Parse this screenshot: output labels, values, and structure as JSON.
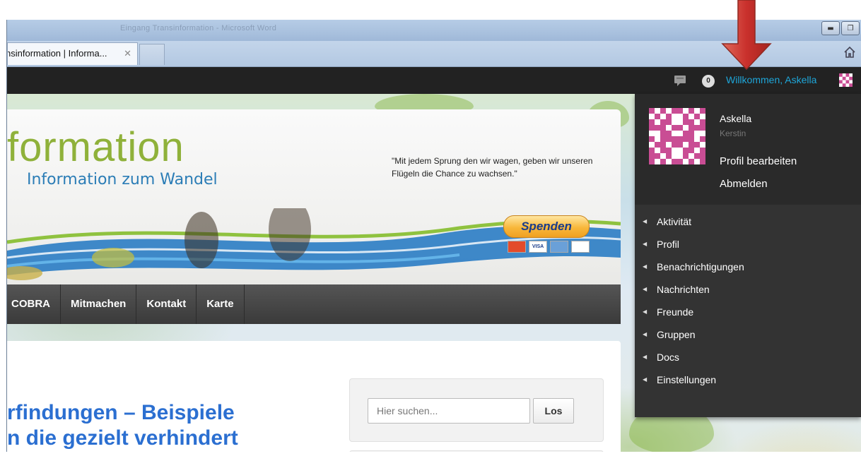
{
  "window": {
    "title": "Eingang Transinformation - Microsoft Word",
    "minimize_icon": "minimize-icon",
    "maximize_icon": "restore-icon"
  },
  "browser": {
    "tab_title": "nsinformation | Informa...",
    "tab_close": "✕",
    "home_icon": "home-icon"
  },
  "adminbar": {
    "comment_icon": "comment-bubble-icon",
    "notification_count": "0",
    "welcome": "Willkommen, Askella"
  },
  "banner": {
    "logo_main": "formation",
    "logo_sub": "Information zum Wandel",
    "quote": "\"Mit jedem Sprung den wir wagen, geben wir unseren Flügeln die Chance zu wachsen.\"",
    "donate": "Spenden",
    "cards": [
      "",
      "VISA",
      "",
      ""
    ]
  },
  "nav": {
    "items": [
      "COBRA",
      "Mitmachen",
      "Kontakt",
      "Karte"
    ]
  },
  "content": {
    "headline_line1": "rfindungen – Beispiele",
    "headline_line2": "n die gezielt verhindert",
    "search_placeholder": "Hier suchen...",
    "search_button": "Los"
  },
  "dropdown": {
    "name": "Askella",
    "subname": "Kerstin",
    "edit_profile": "Profil bearbeiten",
    "logout": "Abmelden",
    "menu": [
      "Aktivität",
      "Profil",
      "Benachrichtigungen",
      "Nachrichten",
      "Freunde",
      "Gruppen",
      "Docs",
      "Einstellungen"
    ]
  },
  "colors": {
    "accent_link": "#1ea6d9",
    "headline": "#2b6fd1",
    "arrow": "#c9302c",
    "logo_green": "#8fb13a"
  }
}
